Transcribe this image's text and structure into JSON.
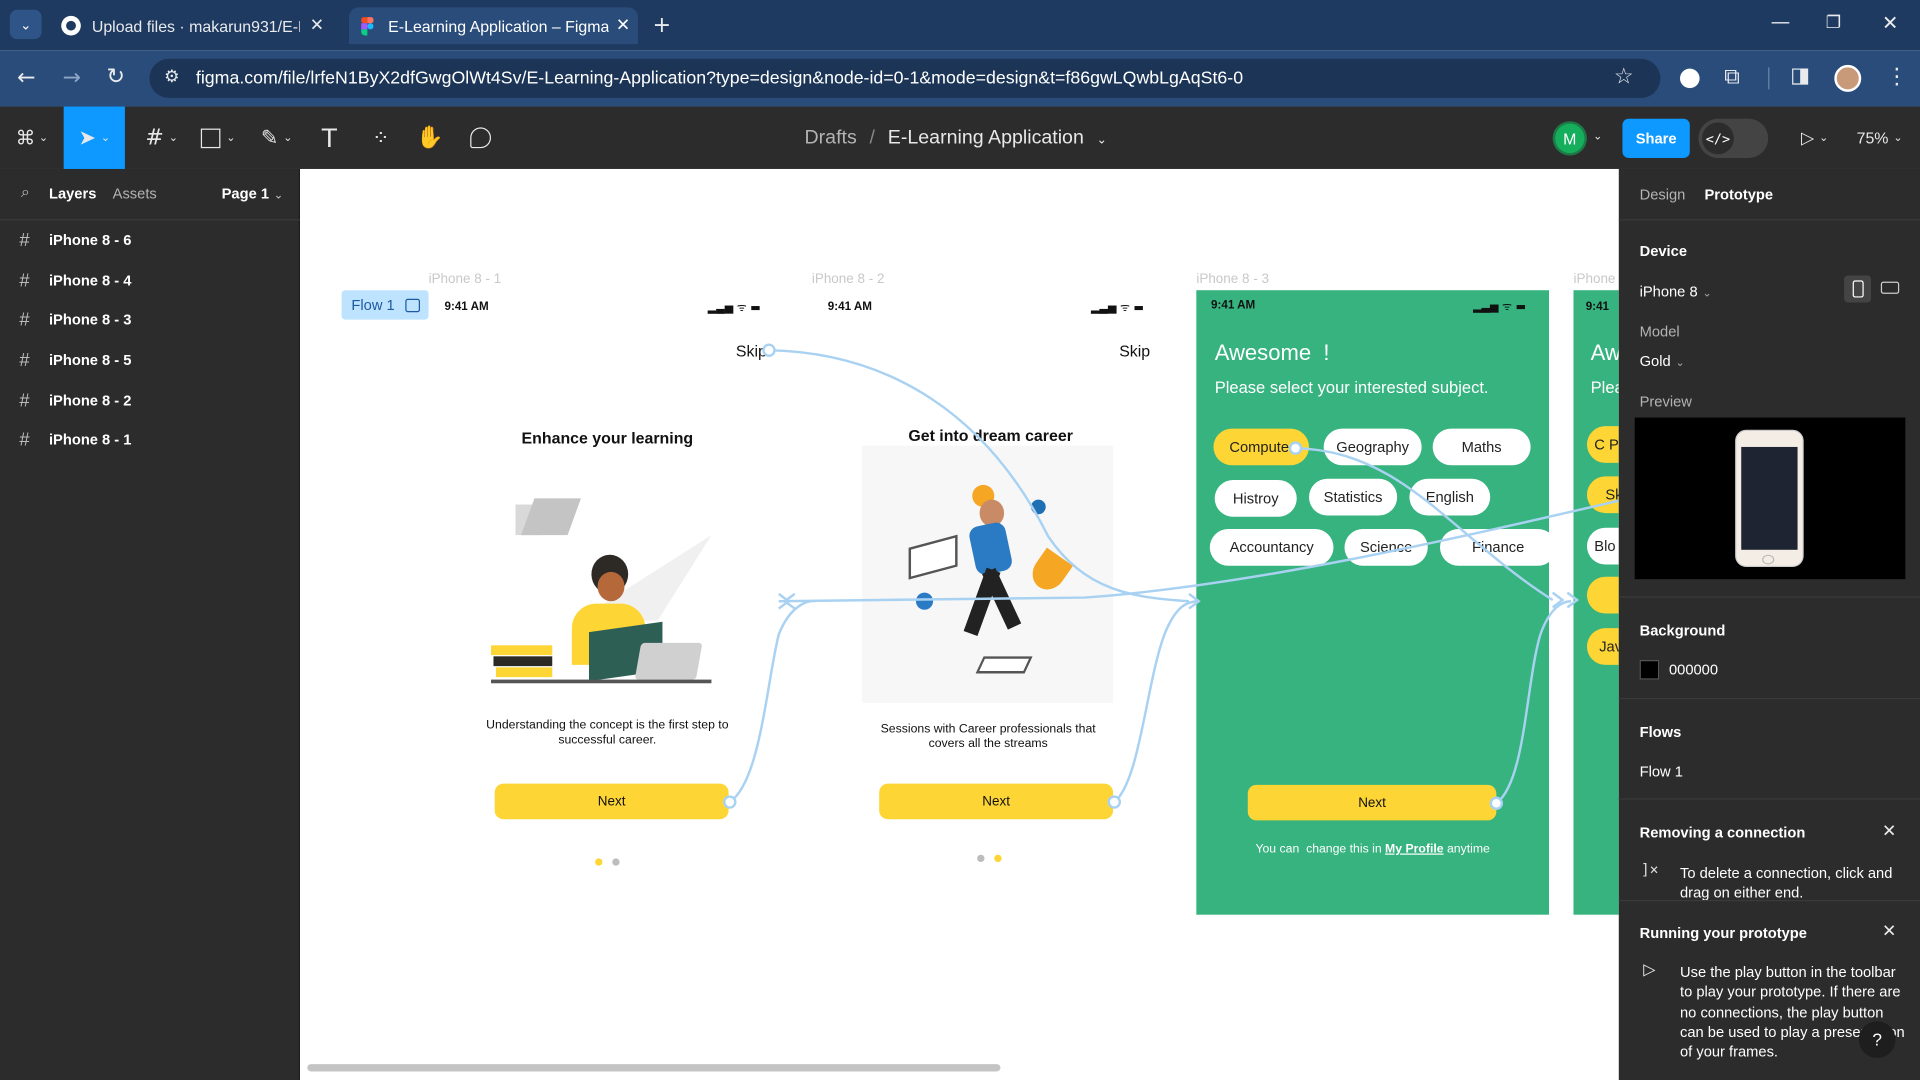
{
  "browser": {
    "tabs": [
      {
        "title": "Upload files · makarun931/E-Le",
        "icon": "github-icon"
      },
      {
        "title": "E-Learning Application – Figma",
        "icon": "figma-icon"
      }
    ],
    "url": "figma.com/file/lrfeN1ByX2dfGwgOlWt4Sv/E-Learning-Application?type=design&node-id=0-1&mode=design&t=f86gwLQwbLgAqSt6-0"
  },
  "toolbar": {
    "breadcrumb_drafts": "Drafts",
    "breadcrumb_sep": "/",
    "file_name": "E-Learning Application",
    "avatar_letter": "M",
    "share_label": "Share",
    "zoom": "75%"
  },
  "left_panel": {
    "tab_layers": "Layers",
    "tab_assets": "Assets",
    "page": "Page 1",
    "layers": [
      "iPhone 8 - 6",
      "iPhone 8 - 4",
      "iPhone 8 - 3",
      "iPhone 8 - 5",
      "iPhone 8 - 2",
      "iPhone 8 - 1"
    ]
  },
  "canvas": {
    "flow_badge": "Flow 1",
    "frame_names": [
      "iPhone 8 - 1",
      "iPhone 8 - 2",
      "iPhone 8 - 3",
      "iPhone"
    ],
    "screen1": {
      "time": "9:41 AM",
      "skip": "Skip",
      "title": "Enhance your learning",
      "body": "Understanding the concept is the first step to successful career.",
      "next": "Next"
    },
    "screen2": {
      "time": "9:41 AM",
      "skip": "Skip",
      "title": "Get into dream career",
      "body": "Sessions with Career professionals that covers all the streams",
      "next": "Next"
    },
    "screen3": {
      "time": "9:41 AM",
      "title": "Awesome  !",
      "subtitle": "Please select your interested subject.",
      "chips": [
        "Compute",
        "Geography",
        "Maths",
        "Histroy",
        "Statistics",
        "English",
        "Accountancy",
        "Science",
        "Finance"
      ],
      "next": "Next",
      "footer_pre": "You can  change this in",
      "footer_link": "My Profile",
      "footer_post": "anytime"
    },
    "screen4": {
      "time": "9:41",
      "title": "Aw",
      "subtitle": "Plea",
      "chips": [
        "C P",
        "Sk",
        "Blo",
        "",
        "Jav"
      ]
    }
  },
  "right_panel": {
    "tab_design": "Design",
    "tab_prototype": "Prototype",
    "device_header": "Device",
    "device_value": "iPhone 8",
    "model_label": "Model",
    "model_value": "Gold",
    "preview_label": "Preview",
    "background_header": "Background",
    "background_value": "000000",
    "background_color": "#000000",
    "flows_header": "Flows",
    "flow_name": "Flow 1",
    "removing_title": "Removing a connection",
    "removing_text": "To delete a connection, click and drag on either end.",
    "running_title": "Running your prototype",
    "running_text": "Use the play button in the toolbar to play your prototype. If there are no connections, the play button can be used to play a presentation of your frames.",
    "help": "?"
  },
  "colors": {
    "accent": "#0d99ff",
    "green_screen": "#36b37e",
    "yellow": "#fdd535",
    "connector": "#a9d2f2"
  }
}
